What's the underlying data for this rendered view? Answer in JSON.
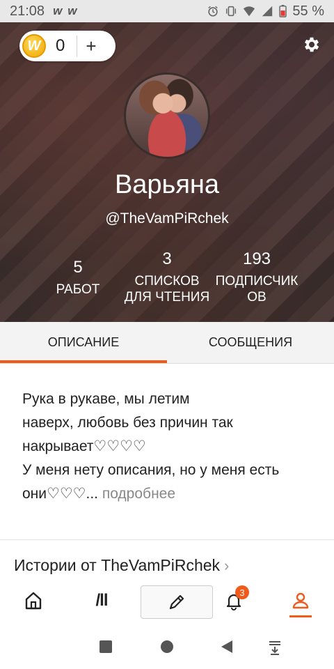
{
  "status_bar": {
    "time": "21:08",
    "app_marks": [
      "w",
      "w"
    ],
    "battery": "55 %"
  },
  "header": {
    "coins": {
      "count": "0",
      "plus": "+",
      "coin_mark": "W"
    },
    "display_name": "Варьяна",
    "username": "@TheVamPiRchek",
    "stats": {
      "works": {
        "value": "5",
        "label": "РАБОТ"
      },
      "reading_lists": {
        "value": "3",
        "label_line1": "СПИСКОВ",
        "label_line2": "ДЛЯ ЧТЕНИЯ"
      },
      "followers": {
        "value": "193",
        "label_line1": "ПОДПИСЧИК",
        "label_line2": "ОВ"
      }
    }
  },
  "tabs": {
    "about": "ОПИСАНИЕ",
    "messages": "СООБЩЕНИЯ"
  },
  "description": {
    "line1": "Рука в рукаве, мы летим",
    "line2": "наверх, любовь без причин так",
    "line3": "накрывает♡♡♡♡",
    "line4": "У меня нету описания, но у меня есть",
    "line5": "они♡♡♡...",
    "more": " подробнее"
  },
  "stories": {
    "heading": "Истории от TheVamPiRchek",
    "chevron": "›"
  },
  "bottom_nav": {
    "library_glyph": "/ll",
    "notification_count": "3"
  },
  "colors": {
    "accent": "#f05a1a",
    "coin": "#f0a800"
  },
  "icons": [
    "home-icon",
    "library-icon",
    "pencil-icon",
    "bell-icon",
    "profile-icon",
    "gear-icon",
    "alarm-icon",
    "vibrate-icon",
    "wifi-icon",
    "signal-icon",
    "battery-icon"
  ]
}
